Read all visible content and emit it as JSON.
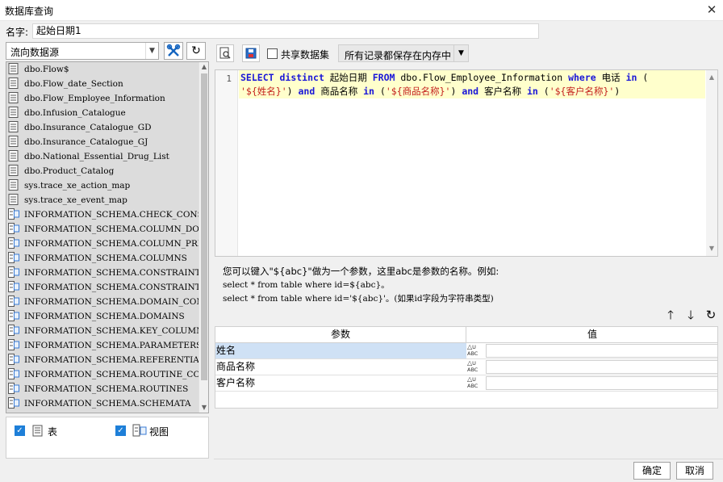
{
  "window": {
    "title": "数据库查询"
  },
  "name_row": {
    "label": "名字:",
    "value": "起始日期1"
  },
  "left": {
    "datasource": "流向数据源",
    "items": [
      {
        "label": "dbo.Flow$",
        "kind": "table"
      },
      {
        "label": "dbo.Flow_date_Section",
        "kind": "table"
      },
      {
        "label": "dbo.Flow_Employee_Information",
        "kind": "table"
      },
      {
        "label": "dbo.Infusion_Catalogue",
        "kind": "table"
      },
      {
        "label": "dbo.Insurance_Catalogue_GD",
        "kind": "table"
      },
      {
        "label": "dbo.Insurance_Catalogue_GJ",
        "kind": "table"
      },
      {
        "label": "dbo.National_Essential_Drug_List",
        "kind": "table"
      },
      {
        "label": "dbo.Product_Catalog",
        "kind": "table"
      },
      {
        "label": "sys.trace_xe_action_map",
        "kind": "table"
      },
      {
        "label": "sys.trace_xe_event_map",
        "kind": "table"
      },
      {
        "label": "INFORMATION_SCHEMA.CHECK_CONSTRAINTS",
        "kind": "view"
      },
      {
        "label": "INFORMATION_SCHEMA.COLUMN_DOMAIN_USAGE",
        "kind": "view"
      },
      {
        "label": "INFORMATION_SCHEMA.COLUMN_PRIVILEGES",
        "kind": "view"
      },
      {
        "label": "INFORMATION_SCHEMA.COLUMNS",
        "kind": "view"
      },
      {
        "label": "INFORMATION_SCHEMA.CONSTRAINT_COLUMN_USAGE",
        "kind": "view"
      },
      {
        "label": "INFORMATION_SCHEMA.CONSTRAINT_TABLE_USAGE",
        "kind": "view"
      },
      {
        "label": "INFORMATION_SCHEMA.DOMAIN_CONSTRAINTS",
        "kind": "view"
      },
      {
        "label": "INFORMATION_SCHEMA.DOMAINS",
        "kind": "view"
      },
      {
        "label": "INFORMATION_SCHEMA.KEY_COLUMN_USAGE",
        "kind": "view"
      },
      {
        "label": "INFORMATION_SCHEMA.PARAMETERS",
        "kind": "view"
      },
      {
        "label": "INFORMATION_SCHEMA.REFERENTIAL_CONSTRAINTS",
        "kind": "view"
      },
      {
        "label": "INFORMATION_SCHEMA.ROUTINE_COLUMNS",
        "kind": "view"
      },
      {
        "label": "INFORMATION_SCHEMA.ROUTINES",
        "kind": "view"
      },
      {
        "label": "INFORMATION_SCHEMA.SCHEMATA",
        "kind": "view"
      }
    ],
    "filter_table": "表",
    "filter_view": "视图"
  },
  "toolbar": {
    "share_label": "共享数据集",
    "memory_option": "所有记录都保存在内存中"
  },
  "editor": {
    "line_number": "1",
    "line1": [
      {
        "t": "SELECT",
        "c": "kw"
      },
      {
        "t": " "
      },
      {
        "t": "distinct",
        "c": "kw"
      },
      {
        "t": " 起始日期 "
      },
      {
        "t": "FROM",
        "c": "kw"
      },
      {
        "t": " dbo.Flow_Employee_Information "
      },
      {
        "t": "where",
        "c": "kw"
      },
      {
        "t": " 电话 "
      },
      {
        "t": "in",
        "c": "kw"
      },
      {
        "t": " ("
      }
    ],
    "line2": [
      {
        "t": "'${姓名}'",
        "c": "str"
      },
      {
        "t": ") "
      },
      {
        "t": "and",
        "c": "kw"
      },
      {
        "t": " 商品名称 "
      },
      {
        "t": "in",
        "c": "kw"
      },
      {
        "t": " ("
      },
      {
        "t": "'${商品名称}'",
        "c": "str"
      },
      {
        "t": ") "
      },
      {
        "t": "and",
        "c": "kw"
      },
      {
        "t": " 客户名称 "
      },
      {
        "t": "in",
        "c": "kw"
      },
      {
        "t": " ("
      },
      {
        "t": "'${客户名称}'",
        "c": "str"
      },
      {
        "t": ")"
      }
    ]
  },
  "help": {
    "line1": "您可以键入\"${abc}\"做为一个参数，这里abc是参数的名称。例如:",
    "line2": "select * from table where id=${abc}。",
    "line3": "select * from table where id='${abc}'。(如果id字段为字符串类型)"
  },
  "params": {
    "col_param": "参数",
    "col_value": "值",
    "type_icon_text": "ABC",
    "rows": [
      {
        "name": "姓名",
        "value": "",
        "selected": true
      },
      {
        "name": "商品名称",
        "value": "",
        "selected": false
      },
      {
        "name": "客户名称",
        "value": "",
        "selected": false
      }
    ]
  },
  "buttons": {
    "ok": "确定",
    "cancel": "取消"
  },
  "colors": {
    "keyword": "#1a17d8",
    "string": "#c4201d",
    "line_highlight": "#ffffcc",
    "checkbox": "#1e7fd8",
    "selected_row": "#cfe1f5"
  }
}
